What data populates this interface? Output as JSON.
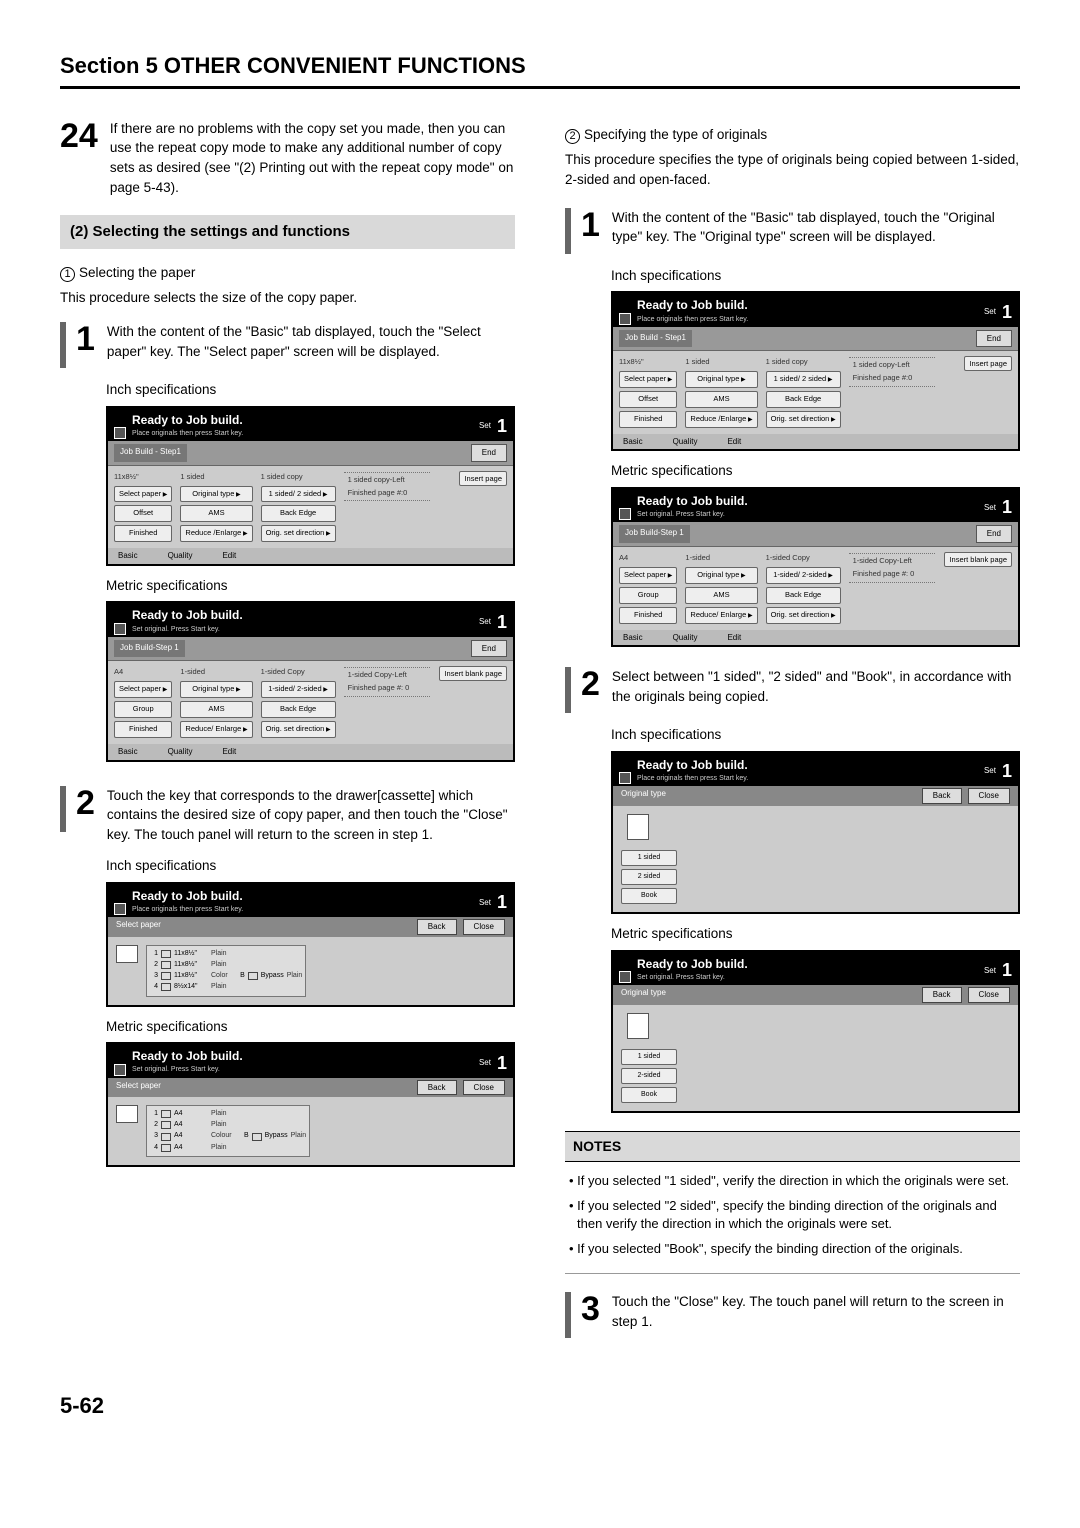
{
  "section_title": "Section 5  OTHER CONVENIENT FUNCTIONS",
  "left": {
    "step24": {
      "num": "24",
      "text": "If there are no problems with the copy set you made, then you can use the repeat copy mode to make any additional number of copy sets as desired (see \"(2) Printing out with the repeat copy mode\" on page 5-43)."
    },
    "subhead": "(2) Selecting the settings and functions",
    "sel1_num": "1",
    "sel1_label": "Selecting the paper",
    "sel1_text": "This procedure selects the size of the copy paper.",
    "step1": {
      "num": "1",
      "text": "With the content of the \"Basic\" tab displayed, touch the \"Select paper\" key. The \"Select paper\" screen will be displayed."
    },
    "spec_inch": "Inch specifications",
    "spec_metric": "Metric specifications",
    "step2": {
      "num": "2",
      "text": "Touch the key that corresponds to the drawer[cassette] which contains the desired size of copy paper, and then touch the \"Close\" key. The touch panel will return to the screen in step 1."
    },
    "panel_inch": {
      "title": "Ready to Job build.",
      "sub": "Place originals then press Start key.",
      "set": "Set",
      "count": "1",
      "crumb": "Job Build - Step1",
      "end": "End",
      "col1": [
        "Select paper",
        "Offset",
        "Finished"
      ],
      "col2": [
        "Original type",
        "AMS",
        "Reduce /Enlarge"
      ],
      "col3_top": [
        "1 sided",
        "1 sided copy"
      ],
      "col3": [
        "1 sided/ 2 sided",
        "Back Edge",
        "Orig. set direction"
      ],
      "status": [
        "1 sided copy-Left",
        "Finished page #:0"
      ],
      "insert": "Insert page",
      "tabs": [
        "Basic",
        "Quality",
        "Edit"
      ],
      "top_size": "11x8½\""
    },
    "panel_metric": {
      "title": "Ready to Job build.",
      "sub": "Set original. Press Start key.",
      "set": "Set",
      "count": "1",
      "crumb": "Job Build-Step 1",
      "end": "End",
      "col1": [
        "Select paper",
        "Group",
        "Finished"
      ],
      "col2": [
        "Original type",
        "AMS",
        "Reduce/ Enlarge"
      ],
      "col3_top": [
        "1-sided",
        "1-sided Copy"
      ],
      "col3": [
        "1-sided/ 2-sided",
        "Back Edge",
        "Orig. set direction"
      ],
      "status": [
        "1-sided Copy-Left",
        "Finished page #: 0"
      ],
      "insert": "Insert blank page",
      "tabs": [
        "Basic",
        "Quality",
        "Edit"
      ],
      "top_size": "A4"
    },
    "select_inch": {
      "title": "Ready to Job build.",
      "sub": "Place originals then press Start key.",
      "set": "Set",
      "count": "1",
      "bar": "Select paper",
      "back": "Back",
      "close": "Close",
      "rows": [
        {
          "n": "1",
          "sz": "11x8½\"",
          "tp": "Plain"
        },
        {
          "n": "2",
          "sz": "11x8½\"",
          "tp": "Plain"
        },
        {
          "n": "3",
          "sz": "11x8½\"",
          "tp": "Color"
        },
        {
          "n": "4",
          "sz": "8½x14\"",
          "tp": "Plain"
        }
      ],
      "bypass": {
        "n": "B",
        "lbl": "Bypass",
        "tp": "Plain"
      }
    },
    "select_metric": {
      "title": "Ready to Job build.",
      "sub": "Set original. Press Start key.",
      "set": "Set",
      "count": "1",
      "bar": "Select paper",
      "back": "Back",
      "close": "Close",
      "rows": [
        {
          "n": "1",
          "sz": "A4",
          "tp": "Plain"
        },
        {
          "n": "2",
          "sz": "A4",
          "tp": "Plain"
        },
        {
          "n": "3",
          "sz": "A4",
          "tp": "Colour"
        },
        {
          "n": "4",
          "sz": "A4",
          "tp": "Plain"
        }
      ],
      "bypass": {
        "n": "B",
        "lbl": "Bypass",
        "tp": "Plain"
      }
    }
  },
  "right": {
    "sel2_num": "2",
    "sel2_label": "Specifying the type of originals",
    "sel2_text": "This procedure specifies the type of originals being copied between 1-sided, 2-sided and open-faced.",
    "step1": {
      "num": "1",
      "text": "With the content of the \"Basic\" tab displayed, touch the \"Original type\" key. The \"Original type\" screen will be displayed."
    },
    "spec_inch": "Inch specifications",
    "spec_metric": "Metric specifications",
    "step2": {
      "num": "2",
      "text": "Select between \"1 sided\", \"2 sided\" and \"Book\", in accordance with the originals being copied."
    },
    "origtype_inch": {
      "title": "Ready to Job build.",
      "sub": "Place originals then press Start key.",
      "set": "Set",
      "count": "1",
      "bar": "Original type",
      "back": "Back",
      "close": "Close",
      "opts": [
        "1 sided",
        "2 sided",
        "Book"
      ]
    },
    "origtype_metric": {
      "title": "Ready to Job build.",
      "sub": "Set original. Press Start key.",
      "set": "Set",
      "count": "1",
      "bar": "Original type",
      "back": "Back",
      "close": "Close",
      "opts": [
        "1 sided",
        "2-sided",
        "Book"
      ]
    },
    "notes_head": "NOTES",
    "notes": [
      "• If you selected \"1 sided\", verify the direction in which the originals were set.",
      "• If you selected \"2 sided\", specify the binding direction of the originals and then verify the direction in which the originals were set.",
      "• If you selected \"Book\", specify the binding direction of the originals."
    ],
    "step3": {
      "num": "3",
      "text": "Touch the \"Close\" key. The touch panel will return to the screen in step 1."
    }
  },
  "page_num": "5-62"
}
